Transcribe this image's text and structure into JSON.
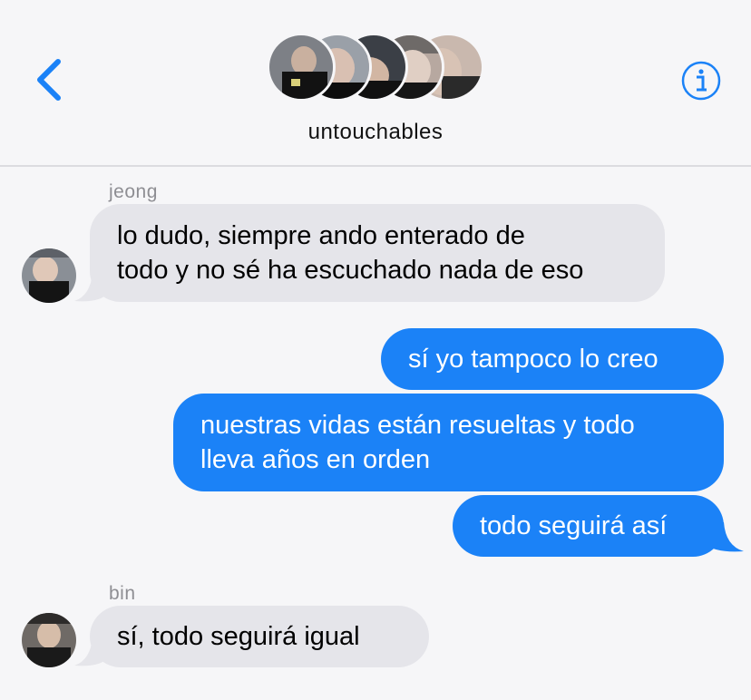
{
  "header": {
    "title": "untouchables",
    "back_icon": "chevron-left-icon",
    "info_icon": "info-circle-icon",
    "accent_color": "#1b82f7"
  },
  "messages": [
    {
      "sender": "jeong",
      "direction": "incoming",
      "text": "lo dudo, siempre ando enterado de\ntodo y no sé ha escuchado nada de eso"
    },
    {
      "direction": "outgoing",
      "text": "sí yo tampoco lo creo"
    },
    {
      "direction": "outgoing",
      "text": "nuestras vidas están resueltas y todo\nlleva años en orden"
    },
    {
      "direction": "outgoing",
      "text": "todo seguirá así"
    },
    {
      "sender": "bin",
      "direction": "incoming",
      "text": "sí, todo seguirá igual"
    }
  ],
  "colors": {
    "incoming_bubble": "#e5e5ea",
    "outgoing_bubble": "#1b82f7",
    "background": "#f6f6f8"
  }
}
